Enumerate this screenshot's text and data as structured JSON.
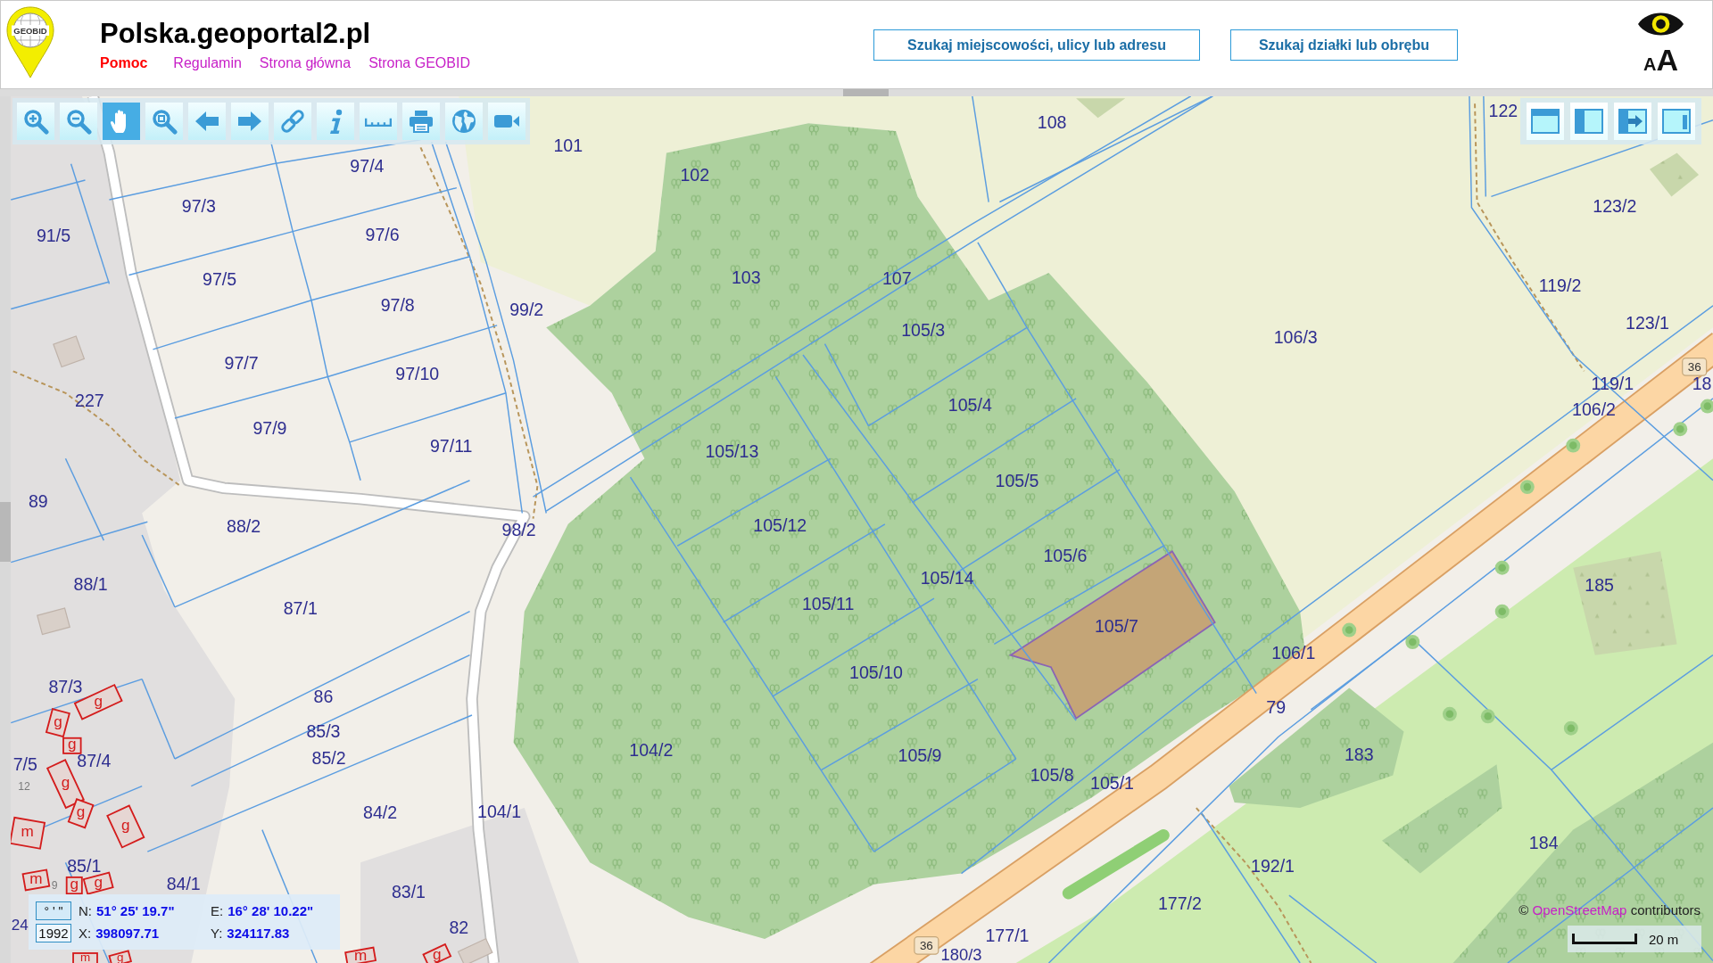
{
  "header": {
    "logo_text": "GEOBID",
    "site_title": "Polska.geoportal2.pl",
    "links": [
      {
        "label": "Pomoc",
        "kind": "help"
      },
      {
        "label": "Regulamin",
        "kind": "link"
      },
      {
        "label": "Strona główna",
        "kind": "link"
      },
      {
        "label": "Strona GEOBID",
        "kind": "link"
      }
    ],
    "search_buttons": [
      "Szukaj miejscowości, ulicy lub adresu",
      "Szukaj działki lub obrębu"
    ],
    "text_size_button": [
      "A",
      "A"
    ]
  },
  "toolbar": {
    "tools": [
      {
        "kind": "zoom-in",
        "selected": false
      },
      {
        "kind": "zoom-out",
        "selected": false
      },
      {
        "kind": "pan",
        "selected": true
      },
      {
        "kind": "zoom-box",
        "selected": false
      },
      {
        "kind": "back",
        "selected": false
      },
      {
        "kind": "forward",
        "selected": false
      },
      {
        "kind": "link",
        "selected": false
      },
      {
        "kind": "info",
        "selected": false
      },
      {
        "kind": "measure",
        "selected": false
      },
      {
        "kind": "print",
        "selected": false
      },
      {
        "kind": "globe",
        "selected": false
      },
      {
        "kind": "video",
        "selected": false
      }
    ]
  },
  "layout_buttons": [
    {
      "kind": "top-panel"
    },
    {
      "kind": "left-panel"
    },
    {
      "kind": "left-panel-collapse"
    },
    {
      "kind": "right-panel"
    }
  ],
  "map": {
    "parcels": [
      "108",
      "122",
      "101",
      "97/4",
      "102",
      "97/3",
      "123/2",
      "91/5",
      "97/6",
      "97/5",
      "103",
      "107",
      "119/2",
      "97/8",
      "99/2",
      "105/3",
      "106/3",
      "123/1",
      "97/7",
      "97/10",
      "119/1",
      "18",
      "227",
      "105/4",
      "106/2",
      "97/9",
      "97/11",
      "105/13",
      "105/5",
      "89",
      "88/2",
      "98/2",
      "105/12",
      "105/6",
      "88/1",
      "105/14",
      "185",
      "87/1",
      "105/11",
      "106/1",
      "105/10",
      "87/3",
      "86",
      "79",
      "85/3",
      "7/5",
      "87/4",
      "85/2",
      "104/2",
      "105/9",
      "183",
      "105/8",
      "105/1",
      "84/2",
      "104/1",
      "184",
      "85/1",
      "192/1",
      "84/1",
      "83/1",
      "177/2",
      "24",
      "82",
      "177/1",
      "180/3"
    ],
    "selected_parcel": {
      "label": "105/7",
      "selected": true
    },
    "road_numbers": [
      "36",
      "36"
    ],
    "house_numbers": [
      "12",
      "9"
    ],
    "building_labels": [
      "g",
      "g",
      "g",
      "g",
      "g",
      "m",
      "g",
      "m",
      "g",
      "g",
      "m",
      "g",
      "m",
      "g"
    ]
  },
  "coordinates": {
    "format_button": "° ' \"",
    "system_button": "1992",
    "fields": [
      {
        "label": "N:",
        "value": "51° 25' 19.7\""
      },
      {
        "label": "E:",
        "value": "16° 28' 10.22\""
      },
      {
        "label": "X:",
        "value": "398097.71"
      },
      {
        "label": "Y:",
        "value": "324117.83"
      }
    ]
  },
  "attribution": {
    "prefix": "©",
    "link": "OpenStreetMap",
    "suffix": "contributors"
  },
  "scale": {
    "label": "20 m"
  }
}
